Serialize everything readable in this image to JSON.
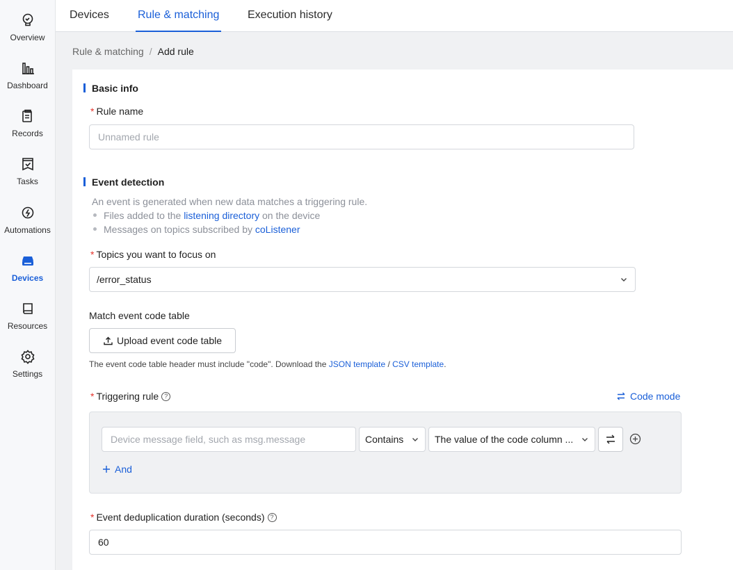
{
  "sidebar": {
    "items": [
      {
        "label": "Overview",
        "icon": "bulb-icon"
      },
      {
        "label": "Dashboard",
        "icon": "bar-chart-icon"
      },
      {
        "label": "Records",
        "icon": "clipboard-icon"
      },
      {
        "label": "Tasks",
        "icon": "task-check-icon"
      },
      {
        "label": "Automations",
        "icon": "automation-icon"
      },
      {
        "label": "Devices",
        "icon": "device-icon",
        "active": true
      },
      {
        "label": "Resources",
        "icon": "book-icon"
      },
      {
        "label": "Settings",
        "icon": "gear-icon"
      }
    ]
  },
  "tabs": {
    "devices": "Devices",
    "rule_matching": "Rule & matching",
    "execution_history": "Execution history"
  },
  "breadcrumb": {
    "parent": "Rule & matching",
    "separator": "/",
    "current": "Add rule"
  },
  "basic_info": {
    "title": "Basic info",
    "rule_name_label": "Rule name",
    "rule_name_placeholder": "Unnamed rule"
  },
  "event_detection": {
    "title": "Event detection",
    "description": "An event is generated when new data matches a triggering rule.",
    "bullet1_pre": "Files added to the ",
    "bullet1_link": "listening directory",
    "bullet1_post": " on the device",
    "bullet2_pre": "Messages on topics subscribed by ",
    "bullet2_link": "coListener",
    "topics_label": "Topics you want to focus on",
    "topics_value": "/error_status",
    "match_table_label": "Match event code table",
    "upload_button": "Upload event code table",
    "note_pre": "The event code table header must include \"code\". Download the ",
    "note_json": "JSON template",
    "note_sep": " / ",
    "note_csv": "CSV template",
    "note_end": ".",
    "triggering_label": "Triggering rule",
    "code_mode": "Code mode",
    "field_placeholder": "Device message field, such as msg.message",
    "operator": "Contains",
    "value_select": "The value of the code column ...",
    "and_button": "And",
    "dedup_label": "Event deduplication duration (seconds)",
    "dedup_value": "60"
  },
  "colors": {
    "accent": "#1a5fd8",
    "required": "#e5332b"
  }
}
